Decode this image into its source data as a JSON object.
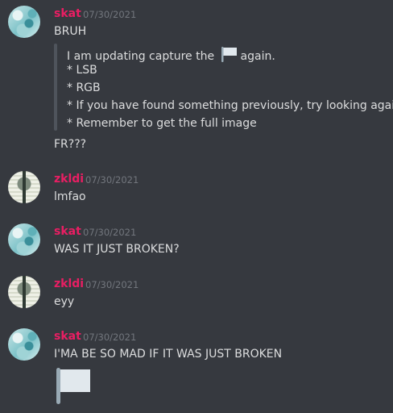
{
  "messages": [
    {
      "author": "skat",
      "timestamp": "07/30/2021",
      "lines": [
        "BRUH"
      ],
      "quote": {
        "first_before": "I am updating capture the",
        "first_after": "again.",
        "lines": [
          "* LSB",
          "* RGB",
          "* If you have found something previously, try looking again",
          "* Remember to get the full image"
        ]
      },
      "after_lines": [
        "FR???"
      ]
    },
    {
      "author": "zkldi",
      "timestamp": "07/30/2021",
      "lines": [
        "lmfao"
      ]
    },
    {
      "author": "skat",
      "timestamp": "07/30/2021",
      "lines": [
        "WAS IT JUST BROKEN?"
      ]
    },
    {
      "author": "zkldi",
      "timestamp": "07/30/2021",
      "lines": [
        "eyy"
      ]
    },
    {
      "author": "skat",
      "timestamp": "07/30/2021",
      "lines": [
        "I'MA BE SO MAD IF IT WAS JUST BROKEN"
      ],
      "emoji": "white-flag"
    }
  ],
  "colors": {
    "username": "#e91e63",
    "background": "#36393f",
    "text": "#dcddde",
    "timestamp": "#72767d"
  }
}
